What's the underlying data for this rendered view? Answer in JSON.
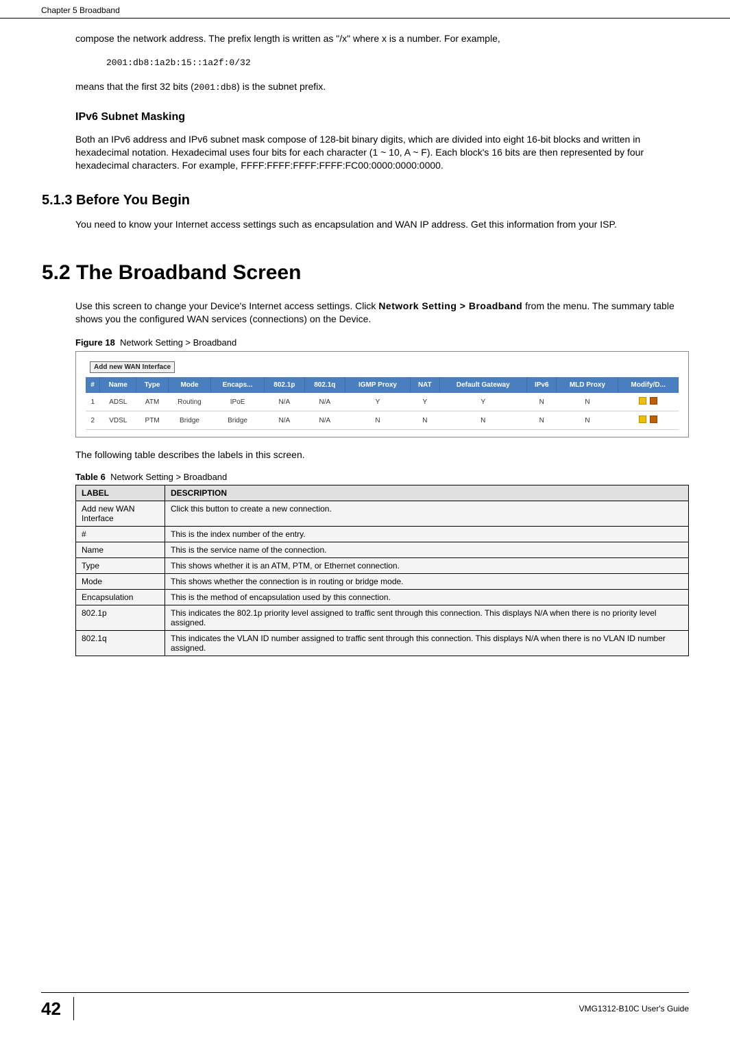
{
  "header": {
    "chapter": "Chapter 5 Broadband"
  },
  "body": {
    "para_prefix_compose": "compose the network address. The prefix length is written as \"/x\" where x is a number. For example,",
    "prefix_example": "2001:db8:1a2b:15::1a2f:0/32",
    "para_means": "means that the first 32 bits (",
    "code_means": "2001:db8",
    "para_means_tail": ") is the subnet prefix.",
    "h_subnet": "IPv6 Subnet Masking",
    "para_subnet": "Both an IPv6 address and IPv6 subnet mask compose of 128-bit binary digits, which are divided into eight 16-bit blocks and written in hexadecimal notation. Hexadecimal uses four bits for each character (1 ~ 10, A ~ F). Each block's 16 bits are then represented by four hexadecimal characters. For example, FFFF:FFFF:FFFF:FFFF:FC00:0000:0000:0000.",
    "h_513": "5.1.3  Before You Begin",
    "para_513": "You need to know your Internet access settings such as encapsulation and WAN IP address. Get this information from your ISP.",
    "h_52": "5.2  The Broadband Screen",
    "para_52_a": "Use this screen to change your Device's Internet access settings. Click ",
    "para_52_b": "Network Setting > Broadband",
    "para_52_c": " from the menu. The summary table shows you the configured WAN services (connections) on the Device.",
    "fig_label": "Figure 18",
    "fig_caption": "Network Setting > Broadband",
    "add_btn": "Add new WAN Interface",
    "wan_headers": [
      "#",
      "Name",
      "Type",
      "Mode",
      "Encaps...",
      "802.1p",
      "802.1q",
      "IGMP Proxy",
      "NAT",
      "Default Gateway",
      "IPv6",
      "MLD Proxy",
      "Modify/D..."
    ],
    "wan_rows": [
      [
        "1",
        "ADSL",
        "ATM",
        "Routing",
        "IPoE",
        "N/A",
        "N/A",
        "Y",
        "Y",
        "Y",
        "N",
        "N",
        ""
      ],
      [
        "2",
        "VDSL",
        "PTM",
        "Bridge",
        "Bridge",
        "N/A",
        "N/A",
        "N",
        "N",
        "N",
        "N",
        "N",
        ""
      ]
    ],
    "para_after_fig": "The following table describes the labels in this screen.",
    "tab_label": "Table 6",
    "tab_caption": "Network Setting > Broadband",
    "desc_headers": [
      "LABEL",
      "DESCRIPTION"
    ],
    "desc_rows": [
      [
        "Add new WAN Interface",
        "Click this button to create a new connection."
      ],
      [
        "#",
        "This is the index number of the entry."
      ],
      [
        "Name",
        "This is the service name of the connection."
      ],
      [
        "Type",
        "This shows whether it is an ATM, PTM, or Ethernet connection."
      ],
      [
        "Mode",
        "This shows whether the connection is in routing or bridge mode."
      ],
      [
        "Encapsulation",
        "This is the method of encapsulation used by this connection."
      ],
      [
        "802.1p",
        "This indicates the 802.1p priority level assigned to traffic sent through this connection. This displays N/A when there is no priority level assigned."
      ],
      [
        "802.1q",
        "This indicates the VLAN ID number assigned to traffic sent through this connection. This displays N/A when there is no VLAN ID number assigned."
      ]
    ]
  },
  "footer": {
    "page": "42",
    "guide": "VMG1312-B10C User's Guide"
  },
  "chart_data": {
    "type": "table",
    "title": "Network Setting > Broadband (configured WAN services)",
    "columns": [
      "#",
      "Name",
      "Type",
      "Mode",
      "Encapsulation",
      "802.1p",
      "802.1q",
      "IGMP Proxy",
      "NAT",
      "Default Gateway",
      "IPv6",
      "MLD Proxy"
    ],
    "rows": [
      {
        "#": 1,
        "Name": "ADSL",
        "Type": "ATM",
        "Mode": "Routing",
        "Encapsulation": "IPoE",
        "802.1p": "N/A",
        "802.1q": "N/A",
        "IGMP Proxy": "Y",
        "NAT": "Y",
        "Default Gateway": "Y",
        "IPv6": "N",
        "MLD Proxy": "N"
      },
      {
        "#": 2,
        "Name": "VDSL",
        "Type": "PTM",
        "Mode": "Bridge",
        "Encapsulation": "Bridge",
        "802.1p": "N/A",
        "802.1q": "N/A",
        "IGMP Proxy": "N",
        "NAT": "N",
        "Default Gateway": "N",
        "IPv6": "N",
        "MLD Proxy": "N"
      }
    ]
  }
}
